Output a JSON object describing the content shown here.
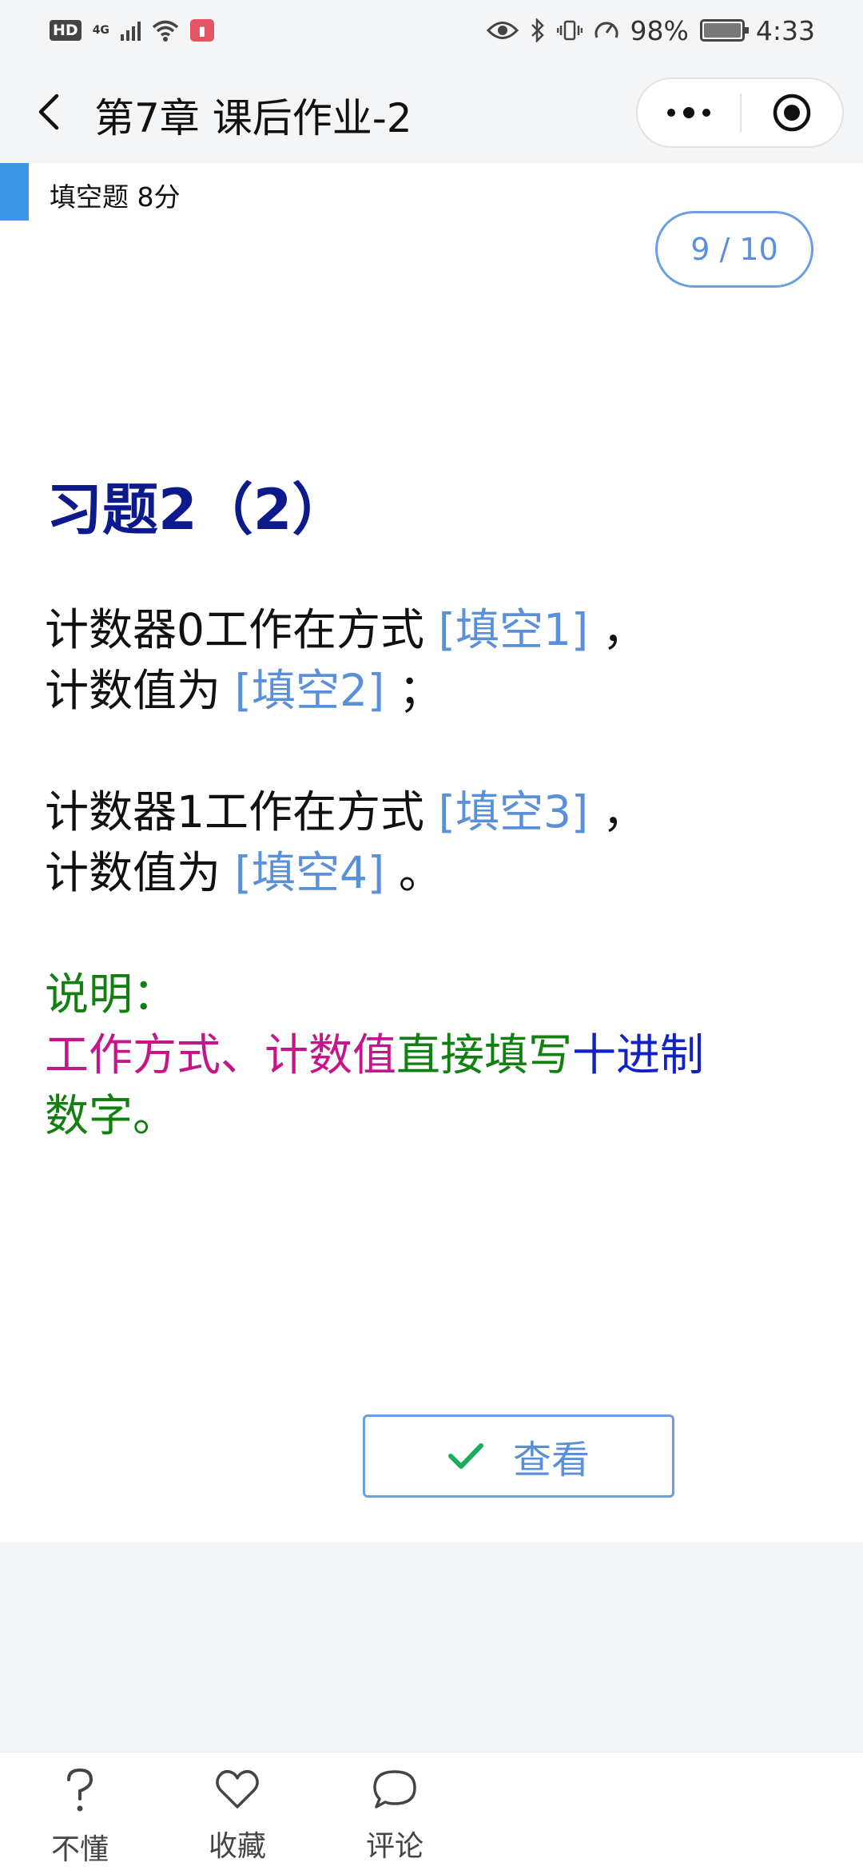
{
  "status_bar": {
    "hd": "HD",
    "network": "4G",
    "battery": "98%",
    "time": "4:33"
  },
  "nav": {
    "title": "第7章 课后作业-2"
  },
  "question": {
    "type_label": "填空题 8分",
    "counter": "9 / 10",
    "title": "习题2（2）",
    "line1_text": "计数器0工作在方式 ",
    "blank1": "[填空1]",
    "line1_end": " ，",
    "line2_text": "计数值为 ",
    "blank2": "[填空2]",
    "line2_end": " ；",
    "line3_text": "计数器1工作在方式 ",
    "blank3": "[填空3]",
    "line3_end": " ，",
    "line4_text": "计数值为 ",
    "blank4": "[填空4]",
    "line4_end": " 。",
    "note_label": "说明：",
    "note_part1": "工作方式、计数值",
    "note_part2": "直接填写",
    "note_part3": "十进制",
    "note_part4": "数字。"
  },
  "actions": {
    "view_label": "查看"
  },
  "bottom_bar": {
    "items": [
      {
        "label": "不懂",
        "icon": "question-icon"
      },
      {
        "label": "收藏",
        "icon": "heart-icon"
      },
      {
        "label": "评论",
        "icon": "comment-icon"
      }
    ]
  },
  "colors": {
    "accent": "#3b97e6",
    "blank": "#5a8fd9",
    "title": "#0c1a8c",
    "green": "#118011",
    "magenta": "#c4168a",
    "blue": "#1021c8",
    "check": "#1aad5a"
  }
}
